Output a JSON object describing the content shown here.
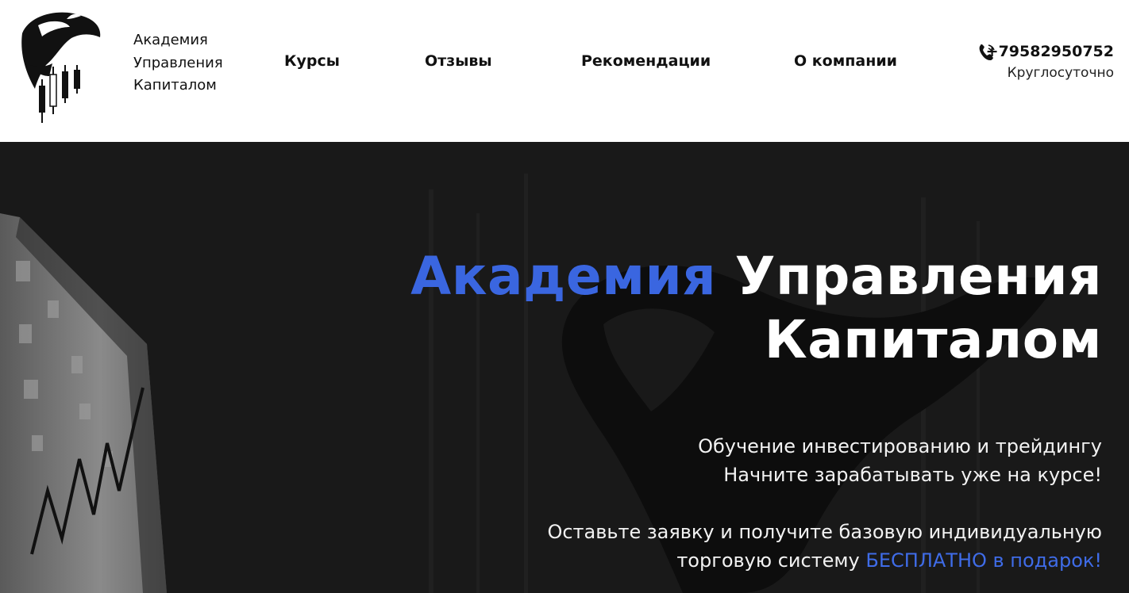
{
  "header": {
    "brand_lines": [
      "Академия",
      "Управления",
      "Капиталом"
    ],
    "nav": [
      {
        "label": "Курсы"
      },
      {
        "label": "Отзывы"
      },
      {
        "label": "Рекомендации"
      },
      {
        "label": "О компании"
      }
    ],
    "phone": "+79582950752",
    "hours": "Круглосуточно",
    "icons": {
      "logo": "orca-candlestick-logo",
      "phone": "phone-icon"
    }
  },
  "hero": {
    "title_accent": "Академия",
    "title_rest_1": "Управления",
    "title_rest_2": "Капиталом",
    "subtitle_1": "Обучение инвестированию и трейдингу",
    "subtitle_2": "Начните зарабатывать уже на курсе!",
    "offer_1": "Оставьте заявку и получите базовую индивидуальную",
    "offer_2_plain": "торговую систему",
    "offer_2_accent": "БЕСПЛАТНО в подарок!"
  },
  "colors": {
    "accent": "#3a66e0",
    "hero_bg": "#181818",
    "header_bg": "#ffffff"
  }
}
